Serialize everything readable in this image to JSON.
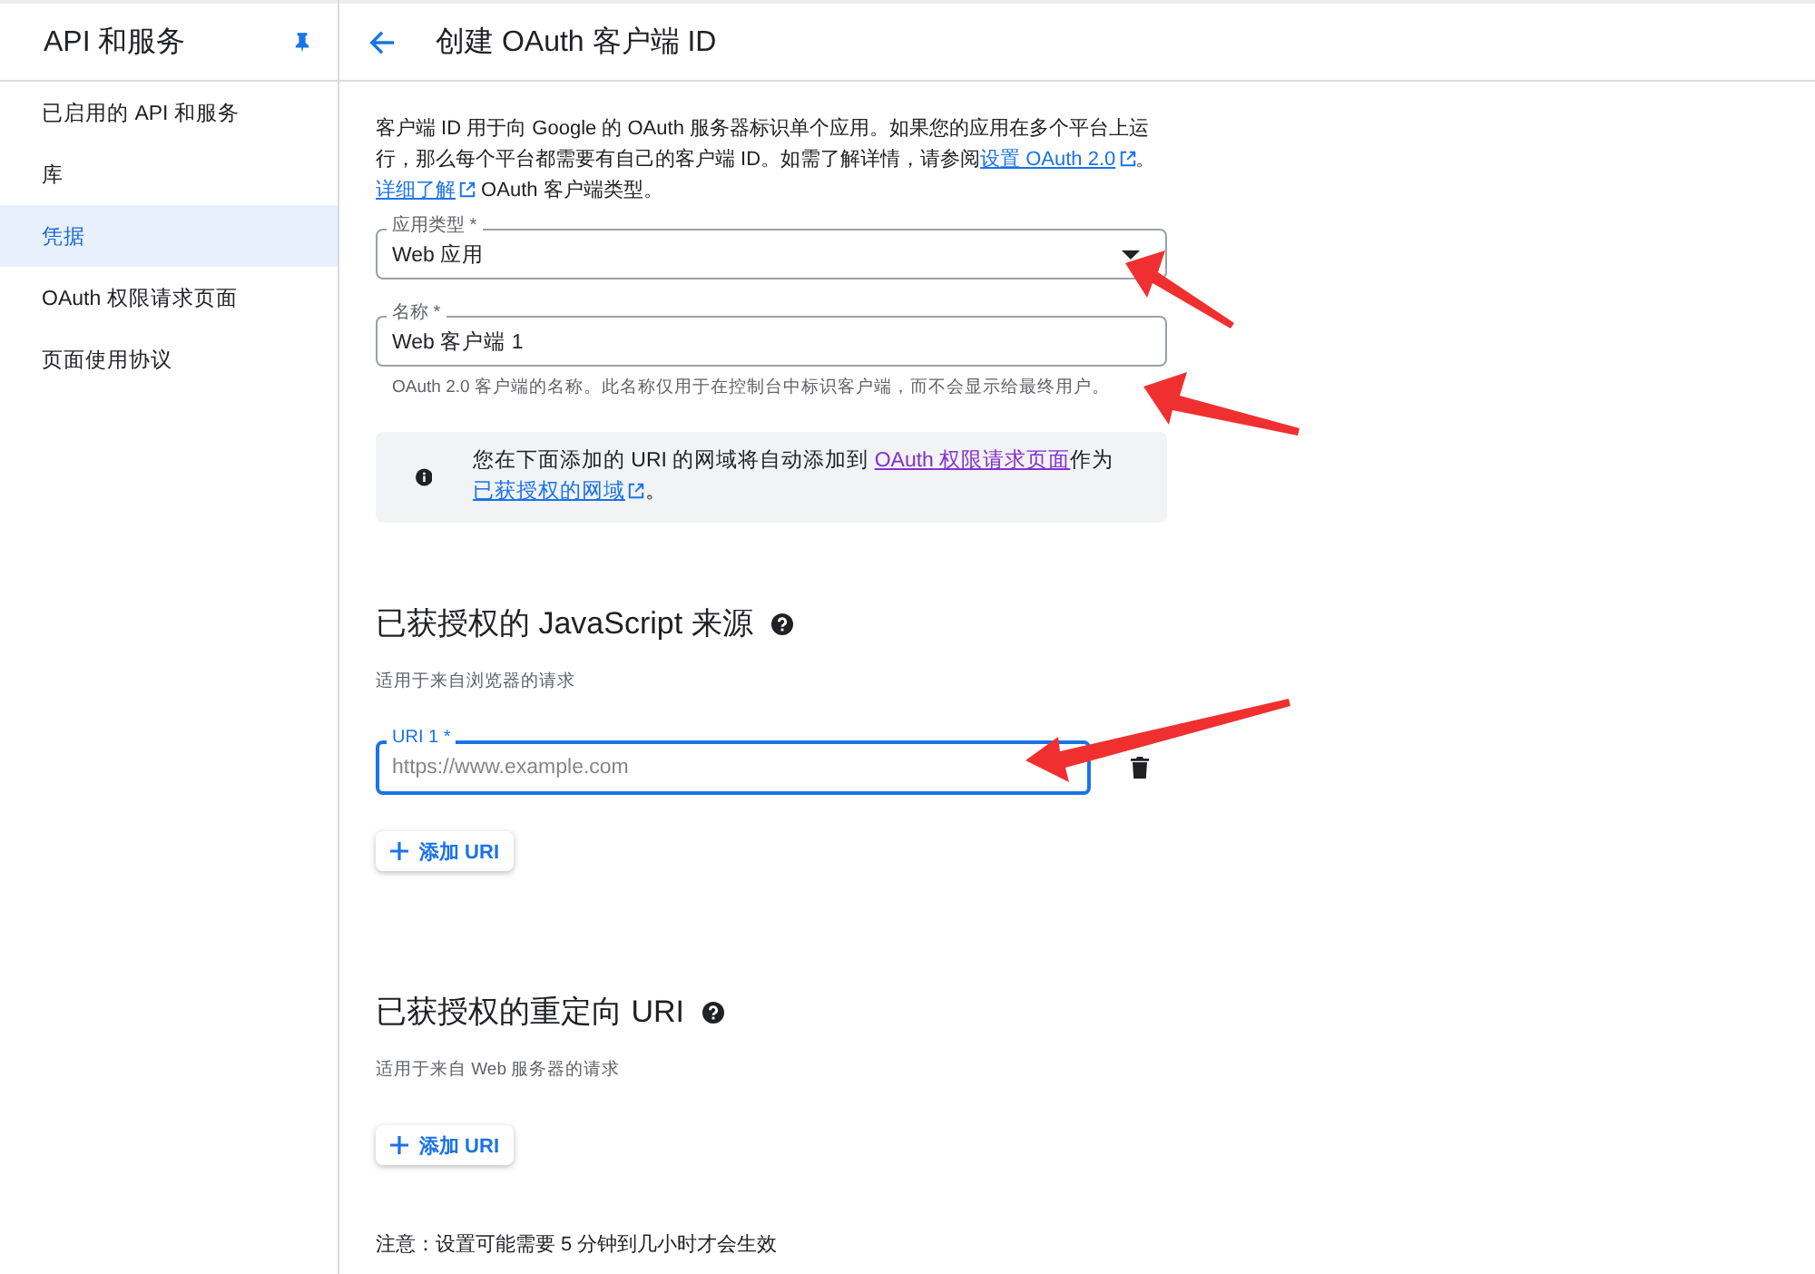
{
  "sidebar": {
    "title": "API 和服务",
    "pinned": true,
    "items": [
      {
        "label": "已启用的 API 和服务",
        "selected": false
      },
      {
        "label": "库",
        "selected": false
      },
      {
        "label": "凭据",
        "selected": true
      },
      {
        "label": "OAuth 权限请求页面",
        "selected": false
      },
      {
        "label": "页面使用协议",
        "selected": false
      }
    ]
  },
  "header": {
    "title": "创建 OAuth 客户端 ID"
  },
  "intro": [
    {
      "kind": "text",
      "text": "客户端 ID 用于向 Google 的 OAuth 服务器标识单个应用。如果您的应用在多个平台上运行，那么每个平台都需要有自己的客户端 ID。如需了解详情，请参阅"
    },
    {
      "kind": "link",
      "text": "设置 OAuth 2.0"
    },
    {
      "kind": "text",
      "text": "。"
    },
    {
      "kind": "link",
      "text": "详细了解"
    },
    {
      "kind": "text",
      "text": " OAuth 客户端类型。"
    }
  ],
  "app_type": {
    "label": "应用类型 *",
    "value": "Web 应用"
  },
  "name_field": {
    "label": "名称 *",
    "value": "Web 客户端 1",
    "hint": "OAuth 2.0 客户端的名称。此名称仅用于在控制台中标识客户端，而不会显示给最终用户。"
  },
  "info": [
    {
      "kind": "text",
      "text": "您在下面添加的 URI 的网域将自动添加到 "
    },
    {
      "kind": "visited",
      "text": "OAuth 权限请求页面"
    },
    {
      "kind": "text",
      "text": "作为"
    },
    {
      "kind": "link",
      "text": "已获授权的网域"
    },
    {
      "kind": "text",
      "text": "。"
    }
  ],
  "sections": [
    {
      "title": "已获授权的 JavaScript 来源",
      "subtitle": "适用于来自浏览器的请求",
      "uris": [
        {
          "label": "URI 1 *",
          "placeholder": "https://www.example.com",
          "focused": true
        }
      ],
      "add_button": "添加 URI"
    },
    {
      "title": "已获授权的重定向 URI",
      "subtitle": "适用于来自 Web 服务器的请求",
      "add_button": "添加 URI"
    }
  ],
  "note": "注意：设置可能需要 5 分钟到几小时才会生效"
}
